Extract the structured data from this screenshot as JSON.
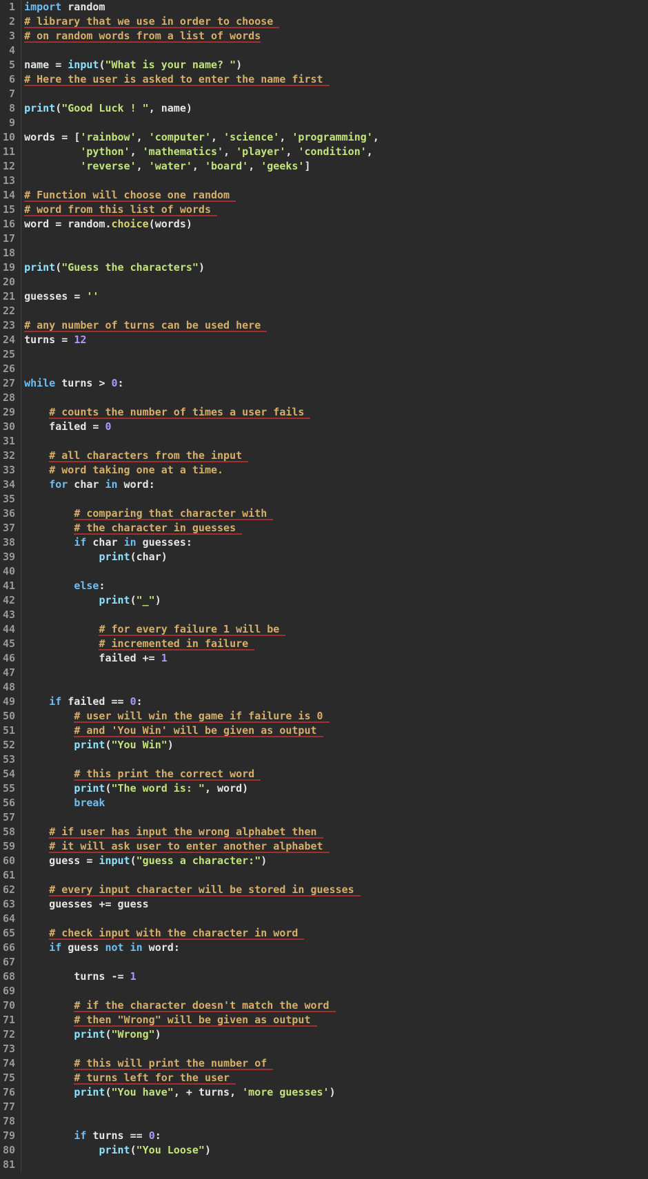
{
  "lines": [
    [
      {
        "c": "t-kw",
        "t": "import"
      },
      {
        "c": "t-name",
        "t": " random"
      }
    ],
    [
      {
        "c": "t-com squig",
        "t": "# library that we use in order to choose "
      }
    ],
    [
      {
        "c": "t-com squig",
        "t": "# on random words from a list of words"
      }
    ],
    [],
    [
      {
        "c": "t-name",
        "t": "name "
      },
      {
        "c": "t-op",
        "t": "= "
      },
      {
        "c": "t-builtin",
        "t": "input"
      },
      {
        "c": "t-punc",
        "t": "("
      },
      {
        "c": "t-str",
        "t": "\"What is your name? \""
      },
      {
        "c": "t-punc",
        "t": ")"
      }
    ],
    [
      {
        "c": "t-com squig",
        "t": "# Here the user is asked to enter the name first "
      }
    ],
    [],
    [
      {
        "c": "t-builtin",
        "t": "print"
      },
      {
        "c": "t-punc",
        "t": "("
      },
      {
        "c": "t-str",
        "t": "\"Good Luck ! \""
      },
      {
        "c": "t-punc",
        "t": ", "
      },
      {
        "c": "t-name",
        "t": "name"
      },
      {
        "c": "t-punc",
        "t": ")"
      }
    ],
    [],
    [
      {
        "c": "t-name",
        "t": "words "
      },
      {
        "c": "t-op",
        "t": "= "
      },
      {
        "c": "t-punc",
        "t": "["
      },
      {
        "c": "t-str",
        "t": "'rainbow'"
      },
      {
        "c": "t-punc",
        "t": ", "
      },
      {
        "c": "t-str",
        "t": "'computer'"
      },
      {
        "c": "t-punc",
        "t": ", "
      },
      {
        "c": "t-str",
        "t": "'science'"
      },
      {
        "c": "t-punc",
        "t": ", "
      },
      {
        "c": "t-str",
        "t": "'programming'"
      },
      {
        "c": "t-punc",
        "t": ","
      }
    ],
    [
      {
        "c": "t-name",
        "t": "         "
      },
      {
        "c": "t-str",
        "t": "'python'"
      },
      {
        "c": "t-punc",
        "t": ", "
      },
      {
        "c": "t-str",
        "t": "'mathematics'"
      },
      {
        "c": "t-punc",
        "t": ", "
      },
      {
        "c": "t-str",
        "t": "'player'"
      },
      {
        "c": "t-punc",
        "t": ", "
      },
      {
        "c": "t-str",
        "t": "'condition'"
      },
      {
        "c": "t-punc",
        "t": ","
      }
    ],
    [
      {
        "c": "t-name",
        "t": "         "
      },
      {
        "c": "t-str",
        "t": "'reverse'"
      },
      {
        "c": "t-punc",
        "t": ", "
      },
      {
        "c": "t-str",
        "t": "'water'"
      },
      {
        "c": "t-punc",
        "t": ", "
      },
      {
        "c": "t-str",
        "t": "'board'"
      },
      {
        "c": "t-punc",
        "t": ", "
      },
      {
        "c": "t-str",
        "t": "'geeks'"
      },
      {
        "c": "t-punc",
        "t": "]"
      }
    ],
    [],
    [
      {
        "c": "t-com squig",
        "t": "# Function will choose one random "
      }
    ],
    [
      {
        "c": "t-com squig",
        "t": "# word from this list of words "
      }
    ],
    [
      {
        "c": "t-name",
        "t": "word "
      },
      {
        "c": "t-op",
        "t": "= "
      },
      {
        "c": "t-name",
        "t": "random"
      },
      {
        "c": "t-punc",
        "t": "."
      },
      {
        "c": "t-attr",
        "t": "choice"
      },
      {
        "c": "t-punc",
        "t": "("
      },
      {
        "c": "t-name",
        "t": "words"
      },
      {
        "c": "t-punc",
        "t": ")"
      }
    ],
    [],
    [],
    [
      {
        "c": "t-builtin",
        "t": "print"
      },
      {
        "c": "t-punc",
        "t": "("
      },
      {
        "c": "t-str",
        "t": "\"Guess the characters\""
      },
      {
        "c": "t-punc",
        "t": ")"
      }
    ],
    [],
    [
      {
        "c": "t-name",
        "t": "guesses "
      },
      {
        "c": "t-op",
        "t": "= "
      },
      {
        "c": "t-str",
        "t": "''"
      }
    ],
    [],
    [
      {
        "c": "t-com squig",
        "t": "# any number of turns can be used here "
      }
    ],
    [
      {
        "c": "t-name",
        "t": "turns "
      },
      {
        "c": "t-op",
        "t": "= "
      },
      {
        "c": "t-num",
        "t": "12"
      }
    ],
    [],
    [],
    [
      {
        "c": "t-kw",
        "t": "while"
      },
      {
        "c": "t-name",
        "t": " turns "
      },
      {
        "c": "t-op",
        "t": "> "
      },
      {
        "c": "t-num",
        "t": "0"
      },
      {
        "c": "t-punc",
        "t": ":"
      }
    ],
    [],
    [
      {
        "c": "t-name",
        "t": "    "
      },
      {
        "c": "t-com squig",
        "t": "# counts the number of times a user fails "
      }
    ],
    [
      {
        "c": "t-name",
        "t": "    failed "
      },
      {
        "c": "t-op",
        "t": "= "
      },
      {
        "c": "t-num",
        "t": "0"
      }
    ],
    [],
    [
      {
        "c": "t-name",
        "t": "    "
      },
      {
        "c": "t-com squig",
        "t": "# all characters from the input "
      }
    ],
    [
      {
        "c": "t-name",
        "t": "    "
      },
      {
        "c": "t-com",
        "t": "# word taking one at a time."
      }
    ],
    [
      {
        "c": "t-name",
        "t": "    "
      },
      {
        "c": "t-kw",
        "t": "for"
      },
      {
        "c": "t-name",
        "t": " char "
      },
      {
        "c": "t-kw",
        "t": "in"
      },
      {
        "c": "t-name",
        "t": " word"
      },
      {
        "c": "t-punc",
        "t": ":"
      }
    ],
    [],
    [
      {
        "c": "t-name",
        "t": "        "
      },
      {
        "c": "t-com squig",
        "t": "# comparing that character with "
      }
    ],
    [
      {
        "c": "t-name",
        "t": "        "
      },
      {
        "c": "t-com squig",
        "t": "# the character in guesses "
      }
    ],
    [
      {
        "c": "t-name",
        "t": "        "
      },
      {
        "c": "t-kw",
        "t": "if"
      },
      {
        "c": "t-name",
        "t": " char "
      },
      {
        "c": "t-kw",
        "t": "in"
      },
      {
        "c": "t-name",
        "t": " guesses"
      },
      {
        "c": "t-punc",
        "t": ":"
      }
    ],
    [
      {
        "c": "t-name",
        "t": "            "
      },
      {
        "c": "t-builtin",
        "t": "print"
      },
      {
        "c": "t-punc",
        "t": "("
      },
      {
        "c": "t-name",
        "t": "char"
      },
      {
        "c": "t-punc",
        "t": ")"
      }
    ],
    [],
    [
      {
        "c": "t-name",
        "t": "        "
      },
      {
        "c": "t-kw",
        "t": "else"
      },
      {
        "c": "t-punc",
        "t": ":"
      }
    ],
    [
      {
        "c": "t-name",
        "t": "            "
      },
      {
        "c": "t-builtin",
        "t": "print"
      },
      {
        "c": "t-punc",
        "t": "("
      },
      {
        "c": "t-str",
        "t": "\"_\""
      },
      {
        "c": "t-punc",
        "t": ")"
      }
    ],
    [],
    [
      {
        "c": "t-name",
        "t": "            "
      },
      {
        "c": "t-com squig",
        "t": "# for every failure 1 will be "
      }
    ],
    [
      {
        "c": "t-name",
        "t": "            "
      },
      {
        "c": "t-com squig",
        "t": "# incremented in failure "
      }
    ],
    [
      {
        "c": "t-name",
        "t": "            failed "
      },
      {
        "c": "t-op",
        "t": "+= "
      },
      {
        "c": "t-num",
        "t": "1"
      }
    ],
    [],
    [],
    [
      {
        "c": "t-name",
        "t": "    "
      },
      {
        "c": "t-kw",
        "t": "if"
      },
      {
        "c": "t-name",
        "t": " failed "
      },
      {
        "c": "t-op",
        "t": "== "
      },
      {
        "c": "t-num",
        "t": "0"
      },
      {
        "c": "t-punc",
        "t": ":"
      }
    ],
    [
      {
        "c": "t-name",
        "t": "        "
      },
      {
        "c": "t-com squig",
        "t": "# user will win the game if failure is 0 "
      }
    ],
    [
      {
        "c": "t-name",
        "t": "        "
      },
      {
        "c": "t-com squig",
        "t": "# and 'You Win' will be given as output "
      }
    ],
    [
      {
        "c": "t-name",
        "t": "        "
      },
      {
        "c": "t-builtin",
        "t": "print"
      },
      {
        "c": "t-punc",
        "t": "("
      },
      {
        "c": "t-str",
        "t": "\"You Win\""
      },
      {
        "c": "t-punc",
        "t": ")"
      }
    ],
    [],
    [
      {
        "c": "t-name",
        "t": "        "
      },
      {
        "c": "t-com squig",
        "t": "# this print the correct word "
      }
    ],
    [
      {
        "c": "t-name",
        "t": "        "
      },
      {
        "c": "t-builtin",
        "t": "print"
      },
      {
        "c": "t-punc",
        "t": "("
      },
      {
        "c": "t-str",
        "t": "\"The word is: \""
      },
      {
        "c": "t-punc",
        "t": ", "
      },
      {
        "c": "t-name",
        "t": "word"
      },
      {
        "c": "t-punc",
        "t": ")"
      }
    ],
    [
      {
        "c": "t-name",
        "t": "        "
      },
      {
        "c": "t-kw",
        "t": "break"
      }
    ],
    [],
    [
      {
        "c": "t-name",
        "t": "    "
      },
      {
        "c": "t-com squig",
        "t": "# if user has input the wrong alphabet then "
      }
    ],
    [
      {
        "c": "t-name",
        "t": "    "
      },
      {
        "c": "t-com squig",
        "t": "# it will ask user to enter another alphabet "
      }
    ],
    [
      {
        "c": "t-name",
        "t": "    guess "
      },
      {
        "c": "t-op",
        "t": "= "
      },
      {
        "c": "t-builtin",
        "t": "input"
      },
      {
        "c": "t-punc",
        "t": "("
      },
      {
        "c": "t-str",
        "t": "\"guess a character:\""
      },
      {
        "c": "t-punc",
        "t": ")"
      }
    ],
    [],
    [
      {
        "c": "t-name",
        "t": "    "
      },
      {
        "c": "t-com squig",
        "t": "# every input character will be stored in guesses "
      }
    ],
    [
      {
        "c": "t-name",
        "t": "    guesses "
      },
      {
        "c": "t-op",
        "t": "+= "
      },
      {
        "c": "t-name",
        "t": "guess"
      }
    ],
    [],
    [
      {
        "c": "t-name",
        "t": "    "
      },
      {
        "c": "t-com squig",
        "t": "# check input with the character in word "
      }
    ],
    [
      {
        "c": "t-name",
        "t": "    "
      },
      {
        "c": "t-kw",
        "t": "if"
      },
      {
        "c": "t-name",
        "t": " guess "
      },
      {
        "c": "t-kw",
        "t": "not"
      },
      {
        "c": "t-name",
        "t": " "
      },
      {
        "c": "t-kw",
        "t": "in"
      },
      {
        "c": "t-name",
        "t": " word"
      },
      {
        "c": "t-punc",
        "t": ":"
      }
    ],
    [],
    [
      {
        "c": "t-name",
        "t": "        turns "
      },
      {
        "c": "t-op",
        "t": "-= "
      },
      {
        "c": "t-num",
        "t": "1"
      }
    ],
    [],
    [
      {
        "c": "t-name",
        "t": "        "
      },
      {
        "c": "t-com squig",
        "t": "# if the character doesn't match the word "
      }
    ],
    [
      {
        "c": "t-name",
        "t": "        "
      },
      {
        "c": "t-com squig",
        "t": "# then \"Wrong\" will be given as output "
      }
    ],
    [
      {
        "c": "t-name",
        "t": "        "
      },
      {
        "c": "t-builtin",
        "t": "print"
      },
      {
        "c": "t-punc",
        "t": "("
      },
      {
        "c": "t-str",
        "t": "\"Wrong\""
      },
      {
        "c": "t-punc",
        "t": ")"
      }
    ],
    [],
    [
      {
        "c": "t-name",
        "t": "        "
      },
      {
        "c": "t-com squig",
        "t": "# this will print the number of "
      }
    ],
    [
      {
        "c": "t-name",
        "t": "        "
      },
      {
        "c": "t-com squig",
        "t": "# turns left for the user "
      }
    ],
    [
      {
        "c": "t-name",
        "t": "        "
      },
      {
        "c": "t-builtin",
        "t": "print"
      },
      {
        "c": "t-punc",
        "t": "("
      },
      {
        "c": "t-str",
        "t": "\"You have\""
      },
      {
        "c": "t-punc",
        "t": ", "
      },
      {
        "c": "t-op",
        "t": "+ "
      },
      {
        "c": "t-name",
        "t": "turns"
      },
      {
        "c": "t-punc",
        "t": ", "
      },
      {
        "c": "t-str",
        "t": "'more guesses'"
      },
      {
        "c": "t-punc",
        "t": ")"
      }
    ],
    [],
    [],
    [
      {
        "c": "t-name",
        "t": "        "
      },
      {
        "c": "t-kw",
        "t": "if"
      },
      {
        "c": "t-name",
        "t": " turns "
      },
      {
        "c": "t-op",
        "t": "== "
      },
      {
        "c": "t-num",
        "t": "0"
      },
      {
        "c": "t-punc",
        "t": ":"
      }
    ],
    [
      {
        "c": "t-name",
        "t": "            "
      },
      {
        "c": "t-builtin",
        "t": "print"
      },
      {
        "c": "t-punc",
        "t": "("
      },
      {
        "c": "t-str",
        "t": "\"You Loose\""
      },
      {
        "c": "t-punc",
        "t": ")"
      }
    ],
    []
  ]
}
